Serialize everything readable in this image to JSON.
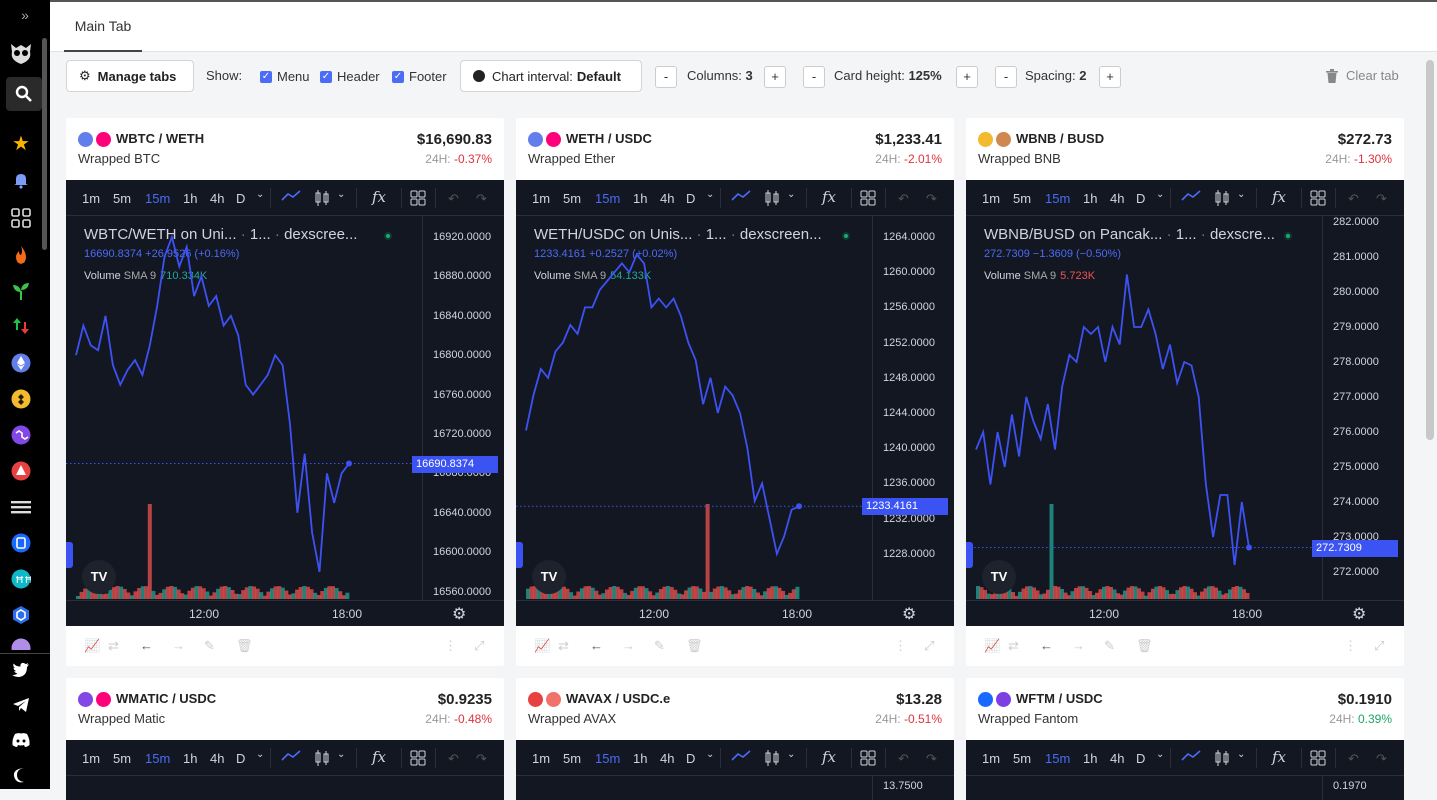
{
  "sidebar": {
    "expand_icon": "double-chevron-right-icon",
    "icons": [
      "owl-logo-icon",
      "search-icon",
      "star-icon",
      "bell-icon",
      "grid-icon",
      "fire-icon",
      "sprout-icon",
      "up-down-arrows-icon",
      "ethereum-icon",
      "bnb-icon",
      "polygon-icon",
      "avalanche-icon",
      "arbitrum-icon",
      "fantom-icon",
      "cronos-icon",
      "optimism-icon",
      "twitter-icon",
      "telegram-icon",
      "discord-icon",
      "moon-icon"
    ]
  },
  "tabs": [
    {
      "label": "Main Tab"
    }
  ],
  "toolbar": {
    "manage_tabs": "Manage tabs",
    "show_label": "Show:",
    "menu": "Menu",
    "header": "Header",
    "footer": "Footer",
    "chart_interval_label": "Chart interval:",
    "chart_interval_value": "Default",
    "columns_label": "Columns:",
    "columns_value": "3",
    "card_height_label": "Card height:",
    "card_height_value": "125%",
    "spacing_label": "Spacing:",
    "spacing_value": "2",
    "minus": "-",
    "plus": "+",
    "clear_tab": "Clear tab"
  },
  "chart_toolbar": {
    "intervals": [
      "1m",
      "5m",
      "15m",
      "1h",
      "4h",
      "D"
    ],
    "active_interval": "15m",
    "fx": "fx"
  },
  "cards": [
    {
      "pair": "WBTC / WETH",
      "name": "Wrapped BTC",
      "price": "$16,690.83",
      "change_label": "24H:",
      "change": "-0.37%",
      "change_dir": "neg",
      "legend_title": "WBTC/WETH on Uni...",
      "legend_interval": "1...",
      "legend_source": "dexscree...",
      "legend_values": "16690.8374  +26.9526 (+0.16%)",
      "volume_label": "Volume",
      "volume_sma": "SMA 9",
      "volume_value": "710.334K",
      "volume_color": "#26a69a",
      "yticks": [
        "16920.0000",
        "16880.0000",
        "16840.0000",
        "16800.0000",
        "16760.0000",
        "16720.0000",
        "16680.0000",
        "16640.0000",
        "16600.0000",
        "16560.0000"
      ],
      "last_price": "16690.8374",
      "xticks": [
        "12:00",
        "18:00"
      ],
      "series": [
        16800,
        16830,
        16810,
        16805,
        16840,
        16790,
        16770,
        16785,
        16795,
        16780,
        16810,
        16850,
        16900,
        16920,
        16890,
        16910,
        16860,
        16880,
        16850,
        16860,
        16830,
        16840,
        16820,
        16770,
        16760,
        16770,
        16780,
        16800,
        16790,
        16730,
        16640,
        16700,
        16620,
        16580,
        16680,
        16650,
        16680,
        16690
      ]
    },
    {
      "pair": "WETH / USDC",
      "name": "Wrapped Ether",
      "price": "$1,233.41",
      "change_label": "24H:",
      "change": "-2.01%",
      "change_dir": "neg",
      "legend_title": "WETH/USDC on Unis...",
      "legend_interval": "1...",
      "legend_source": "dexscreen...",
      "legend_values": "1233.4161  +0.2527 (+0.02%)",
      "volume_label": "Volume",
      "volume_sma": "SMA 9",
      "volume_value": "54.133K",
      "volume_color": "#26a69a",
      "yticks": [
        "1264.0000",
        "1260.0000",
        "1256.0000",
        "1252.0000",
        "1248.0000",
        "1244.0000",
        "1240.0000",
        "1236.0000",
        "1232.0000",
        "1228.0000"
      ],
      "last_price": "1233.4161",
      "xticks": [
        "12:00",
        "18:00"
      ],
      "series": [
        1242,
        1246,
        1249,
        1248,
        1251,
        1252,
        1254,
        1253,
        1256,
        1256,
        1258,
        1259,
        1260,
        1261,
        1260,
        1262,
        1261,
        1256,
        1257,
        1256,
        1257,
        1255,
        1252,
        1250,
        1245,
        1248,
        1244,
        1247,
        1246,
        1244,
        1240,
        1234,
        1236,
        1232,
        1228,
        1230,
        1233,
        1233.4
      ]
    },
    {
      "pair": "WBNB / BUSD",
      "name": "Wrapped BNB",
      "price": "$272.73",
      "change_label": "24H:",
      "change": "-1.30%",
      "change_dir": "neg",
      "legend_title": "WBNB/BUSD on Pancak...",
      "legend_interval": "1...",
      "legend_source": "dexscre...",
      "legend_values": "272.7309  −1.3609 (−0.50%)",
      "volume_label": "Volume",
      "volume_sma": "SMA 9",
      "volume_value": "5.723K",
      "volume_color": "#ef5350",
      "yticks": [
        "282.0000",
        "281.0000",
        "280.0000",
        "279.0000",
        "278.0000",
        "277.0000",
        "276.0000",
        "275.0000",
        "274.0000",
        "273.0000",
        "272.0000"
      ],
      "last_price": "272.7309",
      "xticks": [
        "12:00",
        "18:00"
      ],
      "series": [
        275.5,
        276,
        274.5,
        276,
        275,
        276.5,
        275.3,
        277,
        276.3,
        275.8,
        276.8,
        275.5,
        277.3,
        278.2,
        278,
        279,
        278.8,
        279,
        278,
        279,
        278.5,
        280.5,
        279,
        279,
        279.5,
        278.8,
        277.8,
        278.5,
        277.4,
        278,
        277.9,
        277,
        274.5,
        273,
        274.2,
        274.2,
        272.2,
        274,
        272.7
      ]
    },
    {
      "pair": "WMATIC / USDC",
      "name": "Wrapped Matic",
      "price": "$0.9235",
      "change_label": "24H:",
      "change": "-0.48%",
      "change_dir": "neg"
    },
    {
      "pair": "WAVAX / USDC.e",
      "name": "Wrapped AVAX",
      "price": "$13.28",
      "change_label": "24H:",
      "change": "-0.51%",
      "change_dir": "neg",
      "ytick_top": "13.7500"
    },
    {
      "pair": "WFTM / USDC",
      "name": "Wrapped Fantom",
      "price": "$0.1910",
      "change_label": "24H:",
      "change": "0.39%",
      "change_dir": "pos",
      "ytick_top": "0.1970"
    }
  ],
  "colors": {
    "accent": "#4b6bf7",
    "chart_bg": "#131722",
    "negative": "#e0323c",
    "positive": "#21a366"
  }
}
